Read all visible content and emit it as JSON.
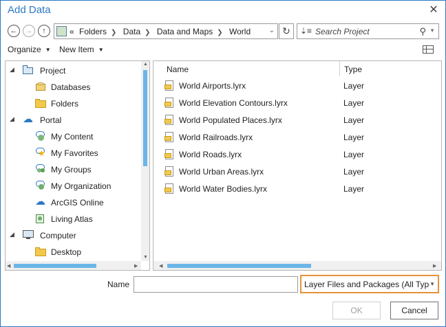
{
  "window": {
    "title": "Add Data"
  },
  "nav": {
    "path": [
      "Folders",
      "Data",
      "Data and Maps",
      "World"
    ],
    "prefix": "«",
    "search_placeholder": "Search Project"
  },
  "toolbar": {
    "organize_label": "Organize",
    "new_item_label": "New Item"
  },
  "tree": [
    {
      "label": "Project",
      "level": 0,
      "expanded": true,
      "icon": "project-icon"
    },
    {
      "label": "Databases",
      "level": 1,
      "icon": "databases-icon"
    },
    {
      "label": "Folders",
      "level": 1,
      "icon": "folder-icon"
    },
    {
      "label": "Portal",
      "level": 0,
      "expanded": true,
      "icon": "cloud-icon"
    },
    {
      "label": "My Content",
      "level": 1,
      "icon": "user-icon"
    },
    {
      "label": "My Favorites",
      "level": 1,
      "icon": "star-icon"
    },
    {
      "label": "My Groups",
      "level": 1,
      "icon": "group-icon"
    },
    {
      "label": "My Organization",
      "level": 1,
      "icon": "organization-icon"
    },
    {
      "label": "ArcGIS Online",
      "level": 1,
      "icon": "cloud-icon"
    },
    {
      "label": "Living Atlas",
      "level": 1,
      "icon": "atlas-icon"
    },
    {
      "label": "Computer",
      "level": 0,
      "expanded": true,
      "icon": "computer-icon"
    },
    {
      "label": "Desktop",
      "level": 1,
      "icon": "folder-icon"
    }
  ],
  "list": {
    "columns": {
      "name": "Name",
      "type": "Type"
    },
    "files": [
      {
        "name": "World Airports.lyrx",
        "type": "Layer"
      },
      {
        "name": "World Elevation Contours.lyrx",
        "type": "Layer"
      },
      {
        "name": "World Populated Places.lyrx",
        "type": "Layer"
      },
      {
        "name": "World Railroads.lyrx",
        "type": "Layer"
      },
      {
        "name": "World Roads.lyrx",
        "type": "Layer"
      },
      {
        "name": "World Urban Areas.lyrx",
        "type": "Layer"
      },
      {
        "name": "World Water Bodies.lyrx",
        "type": "Layer"
      }
    ]
  },
  "bottom": {
    "name_label": "Name",
    "name_value": "",
    "filter_value": "Layer Files and Packages (All Types)",
    "ok_label": "OK",
    "cancel_label": "Cancel"
  },
  "colors": {
    "accent": "#2b78c4",
    "highlight": "#e8913a",
    "scroll": "#6bb6e8"
  }
}
